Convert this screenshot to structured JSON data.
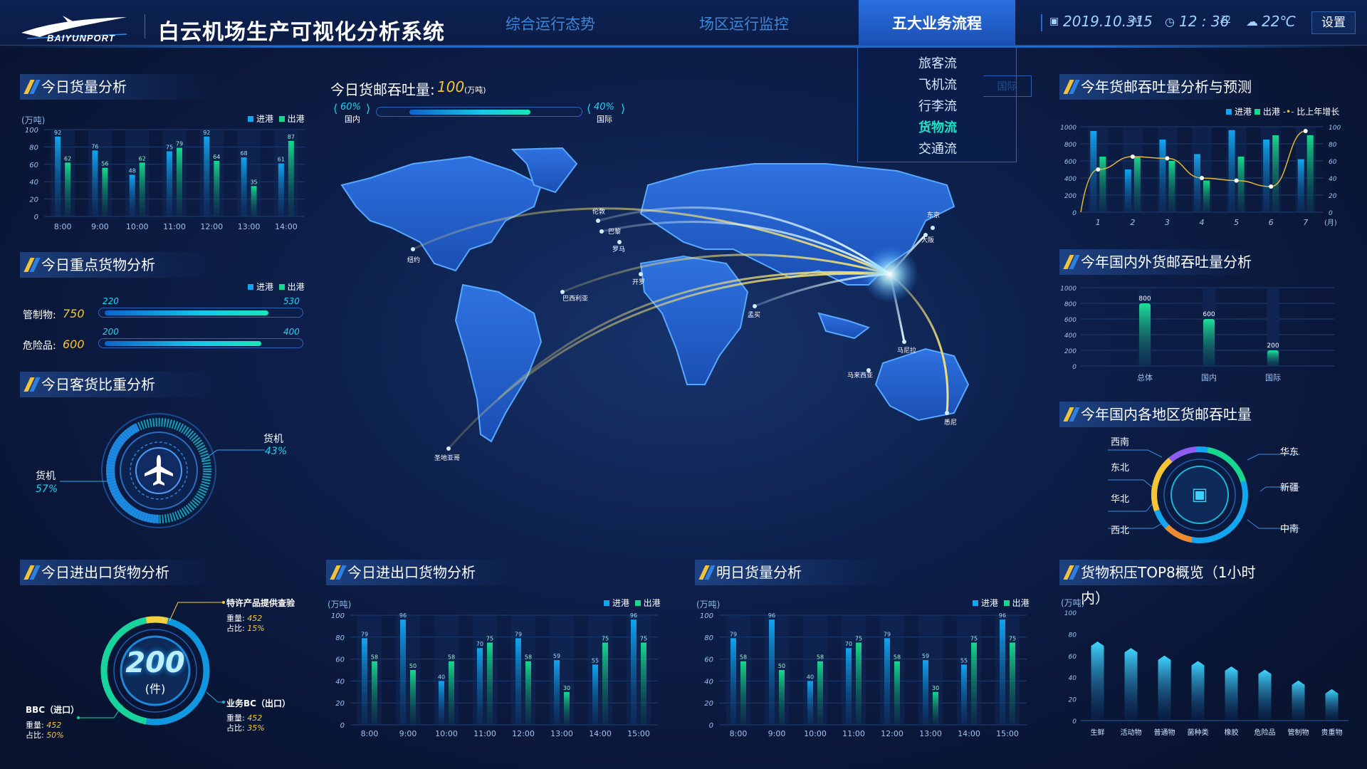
{
  "app": {
    "logo_text": "BAIYUNPORT",
    "title": "白云机场生产可视化分析系统"
  },
  "nav": {
    "tabs": [
      {
        "label": "综合运行态势"
      },
      {
        "label": "场区运行监控"
      },
      {
        "label": "五大业务流程",
        "active": true
      }
    ],
    "dropdown": {
      "items": [
        {
          "label": "旅客流"
        },
        {
          "label": "飞机流"
        },
        {
          "label": "行李流"
        },
        {
          "label": "货物流",
          "selected": true
        },
        {
          "label": "交通流"
        }
      ],
      "ghost_tab": "国际"
    }
  },
  "status": {
    "date": "2019.10.31",
    "weekday_abbr": "SAT",
    "weekday_num": "5",
    "time_hm": "12 : 36",
    "time_s": "30",
    "temperature": "22℃",
    "settings_label": "设置"
  },
  "colors": {
    "in": "#12a5f0",
    "out": "#17d88e",
    "accent_yellow": "#f6c534",
    "accent_cyan": "#1fd3f0"
  },
  "legend": {
    "in": "进港",
    "out": "出港",
    "growth": "比上年增长"
  },
  "today_cargo": {
    "title": "今日货量分析",
    "unit": "(万吨)",
    "chart_data": {
      "type": "bar",
      "categories": [
        "8:00",
        "9:00",
        "10:00",
        "11:00",
        "12:00",
        "13:00",
        "14:00"
      ],
      "series": [
        {
          "name": "进港",
          "values": [
            92,
            76,
            48,
            75,
            92,
            68,
            61
          ]
        },
        {
          "name": "出港",
          "values": [
            62,
            56,
            62,
            79,
            64,
            35,
            87
          ]
        }
      ],
      "labels_in": [
        "92",
        "76",
        "48",
        "75",
        "92",
        "68",
        "61"
      ],
      "labels_out": [
        "62",
        "56",
        "62",
        "79",
        "64",
        "35",
        "87"
      ],
      "yticks": [
        "0",
        "20",
        "40",
        "60",
        "80",
        "100"
      ],
      "ylim": [
        0,
        100
      ]
    }
  },
  "key_cargo": {
    "title": "今日重点货物分析",
    "items": [
      {
        "label": "管制物:",
        "value": "750",
        "in": "220",
        "out": "530"
      },
      {
        "label": "危险品:",
        "value": "600",
        "in": "200",
        "out": "400"
      }
    ]
  },
  "pax_cargo_ratio": {
    "title": "今日客货比重分析",
    "cargo_label": "货机",
    "cargo_pct": "43%",
    "pax_label": "货机",
    "pax_pct": "57%"
  },
  "throughput": {
    "title": "今日货邮吞吐量:",
    "value": "100",
    "unit": "(万吨)",
    "domestic_pct": "60%",
    "domestic_label": "国内",
    "intl_pct": "40%",
    "intl_label": "国际",
    "domestic_fraction": 0.6
  },
  "map": {
    "cities": [
      {
        "name": "纽约"
      },
      {
        "name": "伦敦"
      },
      {
        "name": "巴黎"
      },
      {
        "name": "罗马"
      },
      {
        "name": "开罗"
      },
      {
        "name": "孟买"
      },
      {
        "name": "马尼拉"
      },
      {
        "name": "马来西亚"
      },
      {
        "name": "东京"
      },
      {
        "name": "大阪"
      },
      {
        "name": "巴西利亚"
      },
      {
        "name": "圣地亚哥"
      },
      {
        "name": "悉尼"
      }
    ]
  },
  "year_forecast": {
    "title": "今年货邮吞吐量分析与预测",
    "chart_data": {
      "type": "bar",
      "categories": [
        "1",
        "2",
        "3",
        "4",
        "5",
        "6",
        "7"
      ],
      "xunit": "(月)",
      "series": [
        {
          "name": "进港",
          "values": [
            950,
            500,
            850,
            680,
            960,
            850,
            620
          ]
        },
        {
          "name": "出港",
          "values": [
            650,
            650,
            600,
            370,
            650,
            900,
            900
          ]
        },
        {
          "name": "比上年增长",
          "values": [
            50,
            65,
            63,
            40,
            37,
            30,
            95
          ]
        }
      ],
      "yticks_left": [
        "0",
        "200",
        "400",
        "600",
        "800",
        "1000"
      ],
      "yticks_right": [
        "0",
        "20",
        "40",
        "60",
        "80",
        "100"
      ],
      "ylim_left": [
        0,
        1000
      ],
      "ylim_right": [
        0,
        100
      ]
    }
  },
  "dom_intl": {
    "title": "今年国内外货邮吞吐量分析",
    "chart_data": {
      "type": "bar",
      "categories": [
        "总体",
        "国内",
        "国际"
      ],
      "values": [
        800,
        600,
        200
      ],
      "labels": [
        "800",
        "600",
        "200"
      ],
      "yticks": [
        "0",
        "200",
        "400",
        "600",
        "800",
        "1000"
      ],
      "ylim": [
        0,
        1000
      ]
    }
  },
  "regions": {
    "title": "今年国内各地区货邮吞吐量",
    "left": [
      "西南",
      "东北",
      "华北",
      "西北"
    ],
    "right": [
      "华东",
      "新疆",
      "中南"
    ]
  },
  "import_export": {
    "title": "今日进出口货物分析",
    "center_value": "200",
    "center_unit": "(件)",
    "items": [
      {
        "name": "特许产品提供查验",
        "weight_label": "重量:",
        "weight": "452",
        "ratio_label": "占比:",
        "ratio": "15%"
      },
      {
        "name": "业务BC（出口）",
        "weight_label": "重量:",
        "weight": "452",
        "ratio_label": "占比:",
        "ratio": "35%"
      },
      {
        "name": "BBC（进口）",
        "weight_label": "重量:",
        "weight": "452",
        "ratio_label": "占比:",
        "ratio": "50%"
      }
    ]
  },
  "ie_bars": {
    "title": "今日进出口货物分析",
    "unit": "(万吨)",
    "chart_data": {
      "type": "bar",
      "categories": [
        "8:00",
        "9:00",
        "10:00",
        "11:00",
        "12:00",
        "13:00",
        "14:00",
        "15:00"
      ],
      "series": [
        {
          "name": "进港",
          "values": [
            79,
            96,
            40,
            70,
            79,
            59,
            55,
            96
          ]
        },
        {
          "name": "出港",
          "values": [
            58,
            50,
            58,
            75,
            58,
            30,
            75,
            75
          ]
        }
      ],
      "labels_in": [
        "79",
        "96",
        "40",
        "70",
        "79",
        "59",
        "55",
        "96"
      ],
      "labels_out": [
        "58",
        "50",
        "58",
        "75",
        "58",
        "30",
        "75",
        "75"
      ],
      "yticks": [
        "0",
        "20",
        "40",
        "60",
        "80",
        "100"
      ],
      "ylim": [
        0,
        100
      ]
    }
  },
  "tomorrow": {
    "title": "明日货量分析",
    "unit": "(万吨)",
    "chart_data": {
      "type": "bar",
      "categories": [
        "8:00",
        "9:00",
        "10:00",
        "11:00",
        "12:00",
        "13:00",
        "14:00",
        "15:00"
      ],
      "series": [
        {
          "name": "进港",
          "values": [
            79,
            96,
            40,
            70,
            79,
            59,
            55,
            96
          ]
        },
        {
          "name": "出港",
          "values": [
            58,
            50,
            58,
            75,
            58,
            30,
            75,
            75
          ]
        }
      ],
      "labels_in": [
        "79",
        "96",
        "40",
        "70",
        "79",
        "59",
        "55",
        "96"
      ],
      "labels_out": [
        "58",
        "50",
        "58",
        "75",
        "58",
        "30",
        "75",
        "75"
      ],
      "yticks": [
        "0",
        "20",
        "40",
        "60",
        "80",
        "100"
      ],
      "ylim": [
        0,
        100
      ]
    }
  },
  "backlog": {
    "title": "货物积压TOP8概览（1小时内）",
    "unit": "(万吨)",
    "chart_data": {
      "type": "bar",
      "categories": [
        "生鲜",
        "活动物",
        "普通物",
        "菌种类",
        "橡胶",
        "危险品",
        "管制物",
        "贵重物"
      ],
      "values": [
        73,
        67,
        60,
        55,
        50,
        47,
        37,
        29
      ],
      "yticks": [
        "0",
        "20",
        "40",
        "60",
        "80",
        "100"
      ],
      "ylim": [
        0,
        100
      ]
    }
  }
}
